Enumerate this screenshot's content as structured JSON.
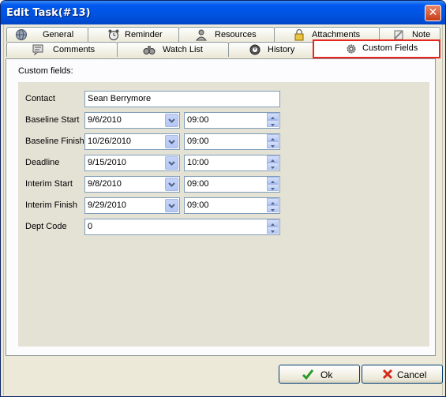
{
  "window": {
    "title": "Edit Task(#13)",
    "close_glyph": "✕"
  },
  "tabs_row1": [
    {
      "label": "General",
      "icon": "globe-icon"
    },
    {
      "label": "Reminder",
      "icon": "alarm-clock-icon"
    },
    {
      "label": "Resources",
      "icon": "user-icon"
    },
    {
      "label": "Attachments",
      "icon": "lock-icon"
    },
    {
      "label": "Note",
      "icon": "pin-icon"
    }
  ],
  "tabs_row2": [
    {
      "label": "Comments",
      "icon": "comments-icon"
    },
    {
      "label": "Watch List",
      "icon": "binoculars-icon"
    },
    {
      "label": "History",
      "icon": "history-icon"
    },
    {
      "label": "Custom Fields",
      "icon": "gear-icon",
      "active": true
    }
  ],
  "panel": {
    "section_label": "Custom fields:"
  },
  "fields": {
    "contact": {
      "label": "Contact",
      "value": "Sean Berrymore"
    },
    "baseline_start": {
      "label": "Baseline Start",
      "date": "9/6/2010",
      "time": "09:00"
    },
    "baseline_finish": {
      "label": "Baseline Finish",
      "date": "10/26/2010",
      "time": "09:00"
    },
    "deadline": {
      "label": "Deadline",
      "date": "9/15/2010",
      "time": "10:00"
    },
    "interim_start": {
      "label": "Interim Start",
      "date": "9/8/2010",
      "time": "09:00"
    },
    "interim_finish": {
      "label": "Interim Finish",
      "date": "9/29/2010",
      "time": "09:00"
    },
    "dept_code": {
      "label": "Dept Code",
      "value": "0"
    }
  },
  "buttons": {
    "ok": "Ok",
    "cancel": "Cancel"
  },
  "colors": {
    "highlight": "#e8261f",
    "title_bar": "#0054e3"
  }
}
